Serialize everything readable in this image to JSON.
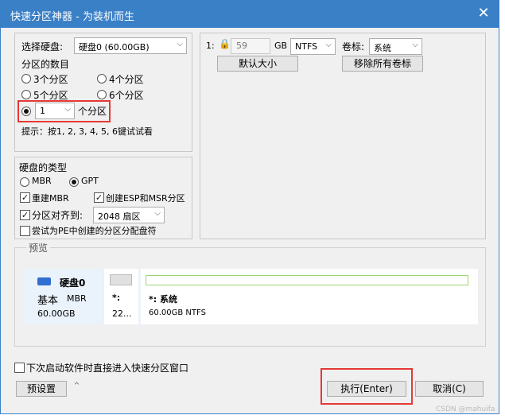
{
  "window": {
    "title": "快速分区神器 - 为装机而生",
    "close_glyph": "✕"
  },
  "left_top": {
    "disk_label": "选择硬盘:",
    "disk_value": "硬盘0 (60.00GB)",
    "count_label": "分区的数目",
    "opt3": "3个分区",
    "opt4": "4个分区",
    "opt5": "5个分区",
    "opt6": "6个分区",
    "custom_value": "1",
    "custom_suffix": "个分区",
    "hint": "提示：按1, 2, 3, 4, 5, 6键试试看"
  },
  "disk_type": {
    "label": "硬盘的类型",
    "mbr": "MBR",
    "gpt": "GPT",
    "rebuild_mbr": "重建MBR",
    "create_esp": "创建ESP和MSR分区",
    "align_label": "分区对齐到:",
    "align_value": "2048 扇区",
    "try_pe": "尝试为PE中创建的分区分配盘符"
  },
  "partition": {
    "index": "1:",
    "size": "59",
    "unit": "GB",
    "fs": "NTFS",
    "volume_label": "卷标:",
    "volume_value": "系统",
    "default_size_btn": "默认大小",
    "remove_labels_btn": "移除所有卷标"
  },
  "preview": {
    "label": "预览",
    "disk_name": "硬盘0",
    "disk_type": "基本",
    "disk_scheme": "MBR",
    "disk_size": "60.00GB",
    "p1_name": "*:",
    "p1_size": "22...",
    "p2_name": "*: 系统",
    "p2_detail": "60.00GB NTFS"
  },
  "footer": {
    "direct_enter": "下次启动软件时直接进入快速分区窗口",
    "preset_btn": "预设置",
    "execute_btn": "执行(Enter)",
    "cancel_btn": "取消(C)",
    "watermark": "CSDN @mahuifa"
  },
  "colors": {
    "titlebar": "#3a80c7",
    "highlight": "#e53935",
    "partition_bar": "#9ed66e"
  }
}
